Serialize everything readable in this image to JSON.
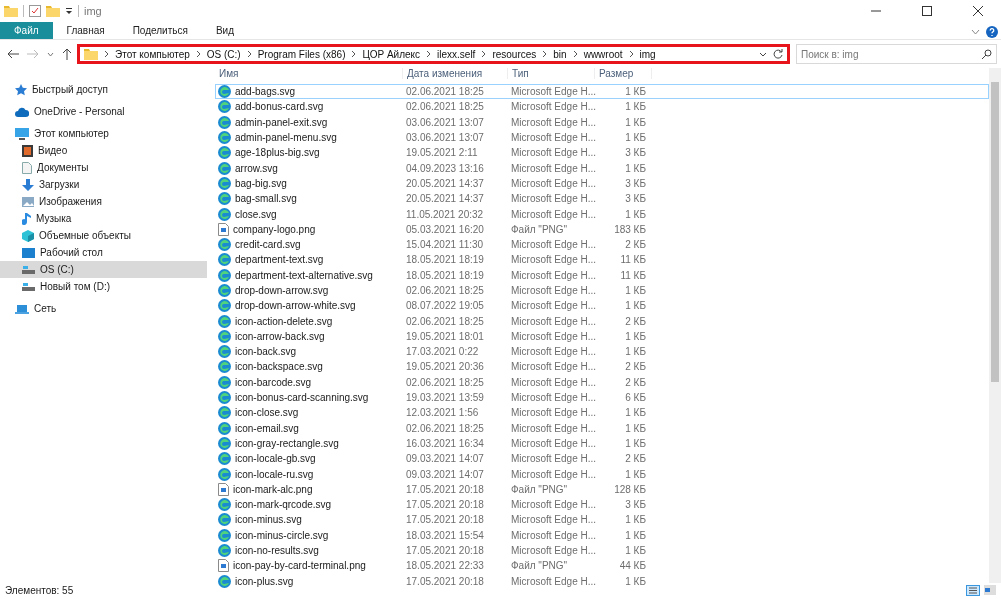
{
  "window": {
    "title": "img"
  },
  "ribbon": {
    "tabs": [
      {
        "label": "Файл",
        "selected": true
      },
      {
        "label": "Главная",
        "selected": false
      },
      {
        "label": "Поделиться",
        "selected": false
      },
      {
        "label": "Вид",
        "selected": false
      }
    ]
  },
  "address": {
    "path": [
      "Этот компьютер",
      "OS (C:)",
      "Program Files (x86)",
      "ЦОР Айлекс",
      "ilexx.self",
      "resources",
      "bin",
      "wwwroot",
      "img"
    ],
    "highlighted": true
  },
  "search": {
    "placeholder": "Поиск в: img"
  },
  "sidebar": {
    "items": [
      {
        "label": "Быстрый доступ",
        "kind": "star",
        "selected": false
      },
      {
        "label": "OneDrive - Personal",
        "kind": "cloud",
        "selected": false
      },
      {
        "label": "Этот компьютер",
        "kind": "computer",
        "selected": false,
        "children": [
          {
            "label": "Видео",
            "kind": "video",
            "selected": false
          },
          {
            "label": "Документы",
            "kind": "document",
            "selected": false
          },
          {
            "label": "Загрузки",
            "kind": "download",
            "selected": false
          },
          {
            "label": "Изображения",
            "kind": "image",
            "selected": false
          },
          {
            "label": "Музыка",
            "kind": "music",
            "selected": false
          },
          {
            "label": "Объемные объекты",
            "kind": "cube",
            "selected": false
          },
          {
            "label": "Рабочий стол",
            "kind": "desktop",
            "selected": false
          },
          {
            "label": "OS (C:)",
            "kind": "drive",
            "selected": true
          },
          {
            "label": "Новый том (D:)",
            "kind": "drive",
            "selected": false
          }
        ]
      },
      {
        "label": "Сеть",
        "kind": "network",
        "selected": false
      }
    ]
  },
  "table": {
    "columns": [
      "Имя",
      "Дата изменения",
      "Тип",
      "Размер"
    ],
    "rows": [
      {
        "name": "add-bags.svg",
        "date": "02.06.2021 18:25",
        "type": "Microsoft Edge H...",
        "size": "1 КБ",
        "kind": "svg",
        "selected": true
      },
      {
        "name": "add-bonus-card.svg",
        "date": "02.06.2021 18:25",
        "type": "Microsoft Edge H...",
        "size": "1 КБ",
        "kind": "svg",
        "selected": false
      },
      {
        "name": "admin-panel-exit.svg",
        "date": "03.06.2021 13:07",
        "type": "Microsoft Edge H...",
        "size": "1 КБ",
        "kind": "svg",
        "selected": false
      },
      {
        "name": "admin-panel-menu.svg",
        "date": "03.06.2021 13:07",
        "type": "Microsoft Edge H...",
        "size": "1 КБ",
        "kind": "svg",
        "selected": false
      },
      {
        "name": "age-18plus-big.svg",
        "date": "19.05.2021 2:11",
        "type": "Microsoft Edge H...",
        "size": "3 КБ",
        "kind": "svg",
        "selected": false
      },
      {
        "name": "arrow.svg",
        "date": "04.09.2023 13:16",
        "type": "Microsoft Edge H...",
        "size": "1 КБ",
        "kind": "svg",
        "selected": false
      },
      {
        "name": "bag-big.svg",
        "date": "20.05.2021 14:37",
        "type": "Microsoft Edge H...",
        "size": "3 КБ",
        "kind": "svg",
        "selected": false
      },
      {
        "name": "bag-small.svg",
        "date": "20.05.2021 14:37",
        "type": "Microsoft Edge H...",
        "size": "3 КБ",
        "kind": "svg",
        "selected": false
      },
      {
        "name": "close.svg",
        "date": "11.05.2021 20:32",
        "type": "Microsoft Edge H...",
        "size": "1 КБ",
        "kind": "svg",
        "selected": false
      },
      {
        "name": "company-logo.png",
        "date": "05.03.2021 16:20",
        "type": "Файл \"PNG\"",
        "size": "183 КБ",
        "kind": "png",
        "selected": false
      },
      {
        "name": "credit-card.svg",
        "date": "15.04.2021 11:30",
        "type": "Microsoft Edge H...",
        "size": "2 КБ",
        "kind": "svg",
        "selected": false
      },
      {
        "name": "department-text.svg",
        "date": "18.05.2021 18:19",
        "type": "Microsoft Edge H...",
        "size": "11 КБ",
        "kind": "svg",
        "selected": false
      },
      {
        "name": "department-text-alternative.svg",
        "date": "18.05.2021 18:19",
        "type": "Microsoft Edge H...",
        "size": "11 КБ",
        "kind": "svg",
        "selected": false
      },
      {
        "name": "drop-down-arrow.svg",
        "date": "02.06.2021 18:25",
        "type": "Microsoft Edge H...",
        "size": "1 КБ",
        "kind": "svg",
        "selected": false
      },
      {
        "name": "drop-down-arrow-white.svg",
        "date": "08.07.2022 19:05",
        "type": "Microsoft Edge H...",
        "size": "1 КБ",
        "kind": "svg",
        "selected": false
      },
      {
        "name": "icon-action-delete.svg",
        "date": "02.06.2021 18:25",
        "type": "Microsoft Edge H...",
        "size": "2 КБ",
        "kind": "svg",
        "selected": false
      },
      {
        "name": "icon-arrow-back.svg",
        "date": "19.05.2021 18:01",
        "type": "Microsoft Edge H...",
        "size": "1 КБ",
        "kind": "svg",
        "selected": false
      },
      {
        "name": "icon-back.svg",
        "date": "17.03.2021 0:22",
        "type": "Microsoft Edge H...",
        "size": "1 КБ",
        "kind": "svg",
        "selected": false
      },
      {
        "name": "icon-backspace.svg",
        "date": "19.05.2021 20:36",
        "type": "Microsoft Edge H...",
        "size": "2 КБ",
        "kind": "svg",
        "selected": false
      },
      {
        "name": "icon-barcode.svg",
        "date": "02.06.2021 18:25",
        "type": "Microsoft Edge H...",
        "size": "2 КБ",
        "kind": "svg",
        "selected": false
      },
      {
        "name": "icon-bonus-card-scanning.svg",
        "date": "19.03.2021 13:59",
        "type": "Microsoft Edge H...",
        "size": "6 КБ",
        "kind": "svg",
        "selected": false
      },
      {
        "name": "icon-close.svg",
        "date": "12.03.2021 1:56",
        "type": "Microsoft Edge H...",
        "size": "1 КБ",
        "kind": "svg",
        "selected": false
      },
      {
        "name": "icon-email.svg",
        "date": "02.06.2021 18:25",
        "type": "Microsoft Edge H...",
        "size": "1 КБ",
        "kind": "svg",
        "selected": false
      },
      {
        "name": "icon-gray-rectangle.svg",
        "date": "16.03.2021 16:34",
        "type": "Microsoft Edge H...",
        "size": "1 КБ",
        "kind": "svg",
        "selected": false
      },
      {
        "name": "icon-locale-gb.svg",
        "date": "09.03.2021 14:07",
        "type": "Microsoft Edge H...",
        "size": "2 КБ",
        "kind": "svg",
        "selected": false
      },
      {
        "name": "icon-locale-ru.svg",
        "date": "09.03.2021 14:07",
        "type": "Microsoft Edge H...",
        "size": "1 КБ",
        "kind": "svg",
        "selected": false
      },
      {
        "name": "icon-mark-alc.png",
        "date": "17.05.2021 20:18",
        "type": "Файл \"PNG\"",
        "size": "128 КБ",
        "kind": "png",
        "selected": false
      },
      {
        "name": "icon-mark-qrcode.svg",
        "date": "17.05.2021 20:18",
        "type": "Microsoft Edge H...",
        "size": "3 КБ",
        "kind": "svg",
        "selected": false
      },
      {
        "name": "icon-minus.svg",
        "date": "17.05.2021 20:18",
        "type": "Microsoft Edge H...",
        "size": "1 КБ",
        "kind": "svg",
        "selected": false
      },
      {
        "name": "icon-minus-circle.svg",
        "date": "18.03.2021 15:54",
        "type": "Microsoft Edge H...",
        "size": "1 КБ",
        "kind": "svg",
        "selected": false
      },
      {
        "name": "icon-no-results.svg",
        "date": "17.05.2021 20:18",
        "type": "Microsoft Edge H...",
        "size": "1 КБ",
        "kind": "svg",
        "selected": false
      },
      {
        "name": "icon-pay-by-card-terminal.png",
        "date": "18.05.2021 22:33",
        "type": "Файл \"PNG\"",
        "size": "44 КБ",
        "kind": "png",
        "selected": false
      },
      {
        "name": "icon-plus.svg",
        "date": "17.05.2021 20:18",
        "type": "Microsoft Edge H...",
        "size": "1 КБ",
        "kind": "svg",
        "selected": false
      }
    ]
  },
  "status_bar": {
    "text": "Элементов: 55"
  }
}
